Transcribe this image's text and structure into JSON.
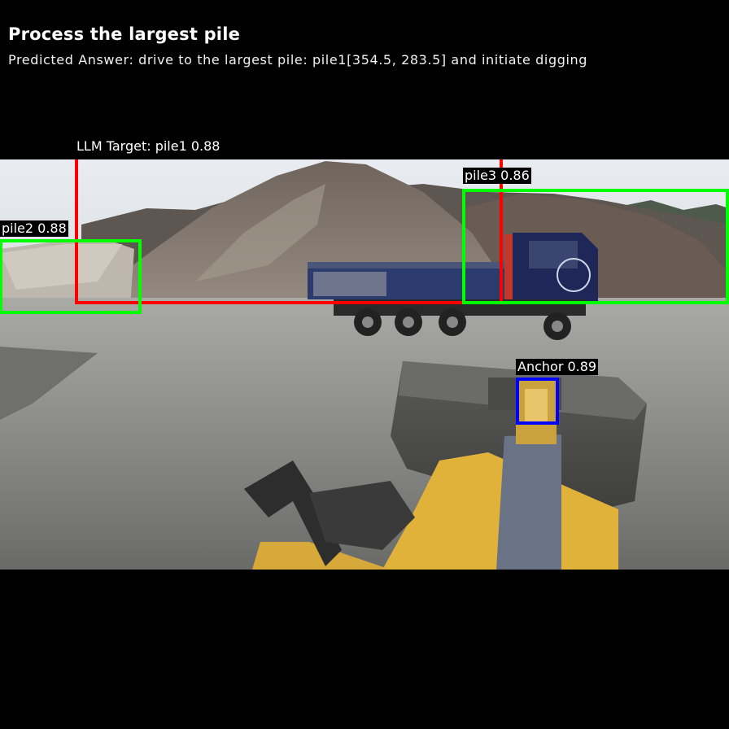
{
  "header": {
    "title": "Process the largest pile",
    "predicted_answer": "Predicted Answer: drive to the largest pile: pile1[354.5, 283.5] and initiate digging"
  },
  "detections": [
    {
      "label": "LLM Target: pile1 0.88",
      "color": "#ff0000"
    },
    {
      "label": "pile2 0.88",
      "color": "#00ff00"
    },
    {
      "label": "pile3 0.86",
      "color": "#00ff00"
    },
    {
      "label": "Anchor 0.89",
      "color": "#0000ff"
    }
  ],
  "colors": {
    "background": "#000000",
    "target_box": "#ff0000",
    "pile_box": "#00ff00",
    "anchor_box": "#0000ff"
  }
}
